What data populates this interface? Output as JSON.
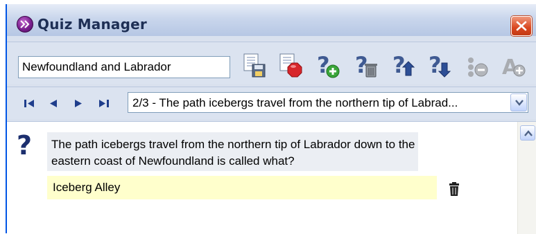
{
  "window": {
    "title": "Quiz Manager",
    "close_icon": "close-x-icon",
    "app_icon": "quiz-app-icon",
    "accent_color": "#0055e5",
    "close_color": "#d9471f"
  },
  "toolbar": {
    "quiz_name_value": "Newfoundland and Labrador",
    "buttons": [
      {
        "icon": "save-quiz-icon"
      },
      {
        "icon": "delete-quiz-icon"
      },
      {
        "icon": "add-question-icon"
      },
      {
        "icon": "delete-question-icon"
      },
      {
        "icon": "move-question-up-icon"
      },
      {
        "icon": "move-question-down-icon"
      },
      {
        "icon": "add-answer-icon"
      },
      {
        "icon": "answer-settings-icon"
      }
    ]
  },
  "navigation": {
    "first_icon": "first-icon",
    "prev_icon": "previous-icon",
    "next_icon": "next-icon",
    "last_icon": "last-icon",
    "selected_question": "2/3 - The path icebergs travel from the northern tip of Labrad...",
    "dropdown_icon": "chevron-down-icon"
  },
  "question": {
    "mark_icon": "question-mark-icon",
    "mark_glyph": "?",
    "text": "The path icebergs travel from the northern tip of Labrador down to the eastern coast of Newfoundland is called what?",
    "answers": [
      {
        "text": "Iceberg Alley",
        "delete_icon": "trash-icon"
      }
    ]
  },
  "scrollbar": {
    "up_icon": "scroll-up-icon"
  }
}
